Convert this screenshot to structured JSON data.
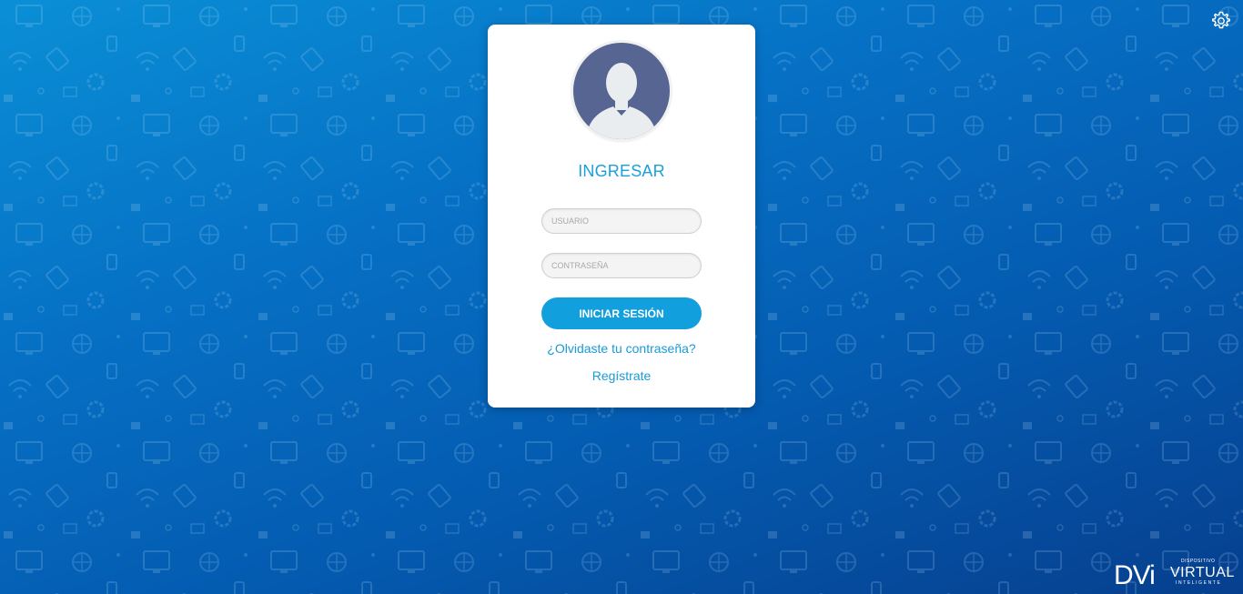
{
  "login": {
    "title": "INGRESAR",
    "username_placeholder": "USUARIO",
    "password_placeholder": "CONTRASEÑA",
    "submit_label": "INICIAR SESIÓN",
    "forgot_label": "¿Olvidaste tu contraseña?",
    "register_label": "Regístrate"
  },
  "brand": {
    "mark": "DVi",
    "top_text": "DISPOSITIVO",
    "main_text": "VIRTUAL",
    "bottom_text": "INTELIGENTE"
  },
  "icons": {
    "settings": "gear-icon",
    "avatar": "user-silhouette-icon"
  },
  "colors": {
    "accent": "#129fdd",
    "link": "#1a9ad8",
    "background_top": "#0a8fd6",
    "background_bottom": "#063f8e",
    "avatar_bg": "#566591"
  }
}
